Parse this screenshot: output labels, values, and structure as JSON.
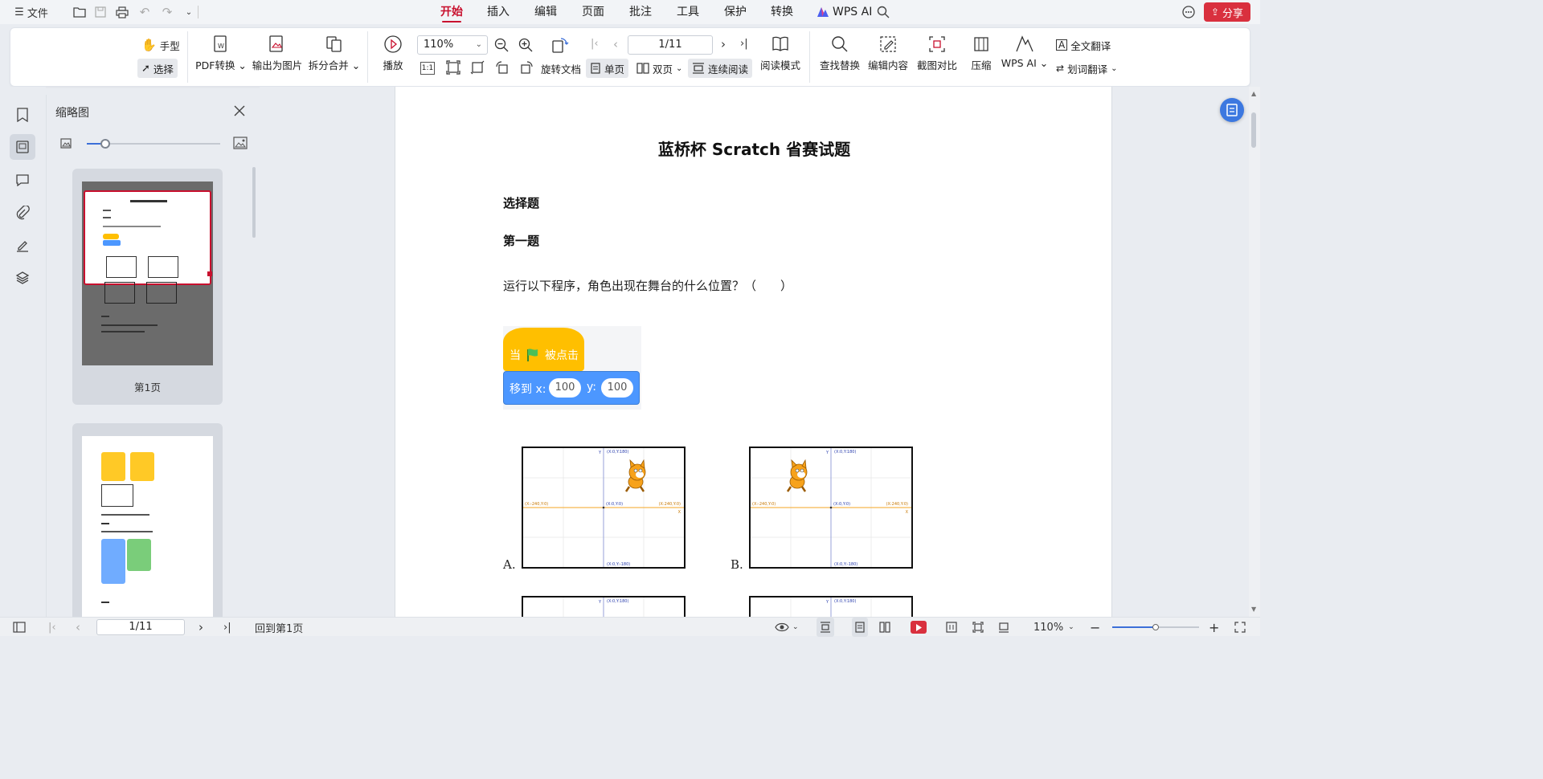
{
  "menubar": {
    "file_label": "文件",
    "tabs": [
      {
        "label": "开始",
        "active": true
      },
      {
        "label": "插入"
      },
      {
        "label": "编辑"
      },
      {
        "label": "页面"
      },
      {
        "label": "批注"
      },
      {
        "label": "工具"
      },
      {
        "label": "保护"
      },
      {
        "label": "转换"
      }
    ],
    "wps_ai_label": "WPS AI",
    "share_label": "分享"
  },
  "ribbon": {
    "hand_label": "手型",
    "select_label": "选择",
    "pdf_convert_label": "PDF转换",
    "export_image_label": "输出为图片",
    "split_merge_label": "拆分合并",
    "play_label": "播放",
    "zoom_value": "110%",
    "page_value": "1/11",
    "rotate_label": "旋转文档",
    "single_page_label": "单页",
    "double_page_label": "双页",
    "continuous_label": "连续阅读",
    "reading_mode_label": "阅读模式",
    "find_replace_label": "查找替换",
    "edit_content_label": "编辑内容",
    "screenshot_compare_label": "截图对比",
    "compress_label": "压缩",
    "wps_ai_label": "WPS AI",
    "full_translate_label": "全文翻译",
    "word_translate_label": "划词翻译",
    "one_to_one": "1:1"
  },
  "thumbnails": {
    "title": "缩略图",
    "page1_caption": "第1页",
    "slider_value": 0.14
  },
  "document": {
    "title": "蓝桥杯 Scratch 省赛试题",
    "section": "选择题",
    "question_heading": "第一题",
    "question_text": "运行以下程序，角色出现在舞台的什么位置？（　　）",
    "block_when_flag_prefix": "当",
    "block_when_flag_suffix": "被点击",
    "block_goto": "移到 x:",
    "block_y": "y:",
    "block_x_value": "100",
    "block_y_value": "100",
    "option_a": "A.",
    "option_b": "B.",
    "stage_labels": {
      "top": "(X:0,Y:180)",
      "bottom": "(X:0,Y:-180)",
      "left": "(X:-240,Y:0)",
      "right": "(X:240,Y:0)",
      "center": "(X:0,Y:0)",
      "x_axis": "X",
      "y_axis": "Y"
    }
  },
  "statusbar": {
    "page_value": "1/11",
    "back_first_label": "回到第1页",
    "zoom_value": "110%",
    "zoom_slider_value": 0.5
  },
  "colors": {
    "accent_red": "#c8102e",
    "share_red": "#d9303e",
    "scratch_yellow": "#ffbf00",
    "scratch_blue": "#4c97ff",
    "selection_blue": "#3c6fd8"
  }
}
